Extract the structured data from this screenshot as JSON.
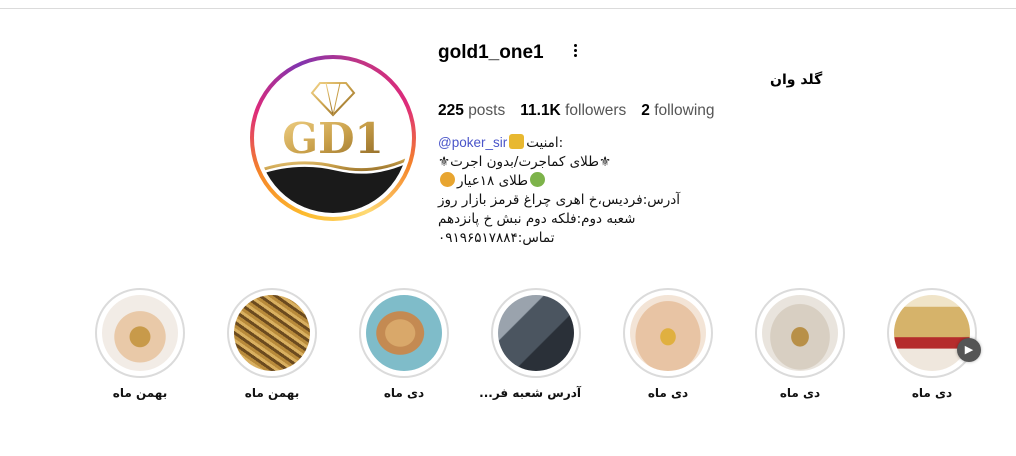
{
  "profile": {
    "username": "gold1_one1",
    "full_name": "گلد وان",
    "stats": {
      "posts_count": "225",
      "posts_label": "posts",
      "followers_count": "11.1K",
      "followers_label": "followers",
      "following_count": "2",
      "following_label": "following"
    },
    "avatar_logo_text": "GD1",
    "bio": {
      "mention": "@poker_sir",
      "line1_text": ":امنیت",
      "line2": "⚜طلای کماجرت/بدون اجرت⚜",
      "line3": "طلای ۱۸عیار",
      "line4": "آدرس:فردیس،خ اهری چراغ قرمز بازار روز",
      "line5": "شعبه دوم:فلکه دوم نبش خ پانزدهم",
      "line6": "تماس:۰۹۱۹۶۵۱۷۸۸۴"
    }
  },
  "highlights": [
    {
      "label": "بهمن ماه",
      "thumb_tag": "@gold1_one1"
    },
    {
      "label": "بهمن ماه"
    },
    {
      "label": "دی ماه"
    },
    {
      "label": "آدرس شعبه فر..."
    },
    {
      "label": "دی ماه"
    },
    {
      "label": "دی ماه"
    },
    {
      "label": "دی ماه"
    }
  ],
  "colors": {
    "gold": "#c9a04a",
    "mention_blue": "#4a55c9",
    "ring_gradient": [
      "#fdbb2d",
      "#f58529",
      "#dd2a7b",
      "#8134af"
    ]
  },
  "icons": {
    "options": "more-options-icon",
    "next": "chevron-right-icon"
  }
}
